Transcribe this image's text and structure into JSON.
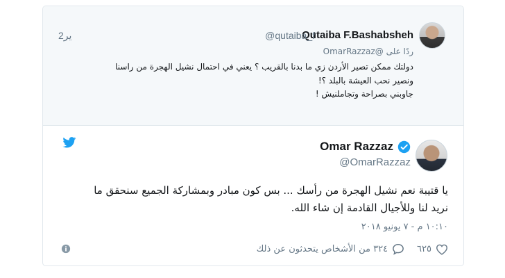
{
  "parent_tweet": {
    "name": "Qutaiba F.Bashabsheh",
    "handle": "@qutaiba_f",
    "time": "2یر",
    "replying_prefix": "ردًا على",
    "replying_to": "@OmarRazzaz",
    "text_line_1": "دولتك ممكن تصير الأردن زي ما بدنا بالقريب ؟ يعني في احتمال نشيل الهجرة من راسنا",
    "text_line_2": "ونصير نحب العيشة بالبلد ؟!",
    "text_line_3": "جاوبني بصراحة وتجاملنيش !"
  },
  "main_tweet": {
    "name": "Omar Razzaz",
    "handle": "@OmarRazzaz",
    "text_line_1": "يا قتيبة  نعم نشيل الهجرة من رأسك ... بس كون مبادر  وبمشاركة الجميع سنحقق ما",
    "text_line_2": "نريد لنا وللأجيال القادمة إن شاء الله.",
    "timestamp": "١٠:١٠ م - ٧ يونيو ٢٠١٨",
    "likes": "٦٢٥",
    "replies_text": "٣٢٤ من الأشخاص يتحدثون عن ذلك"
  },
  "icons": {
    "bird": "twitter-bird-icon",
    "verified": "verified-badge-icon",
    "heart": "heart-icon",
    "reply": "reply-bubble-icon",
    "info": "info-icon"
  },
  "colors": {
    "brand_blue": "#1da1f2",
    "secondary_text": "#657786",
    "border": "#e1e8ed",
    "parent_background": "#f5f8fa"
  }
}
